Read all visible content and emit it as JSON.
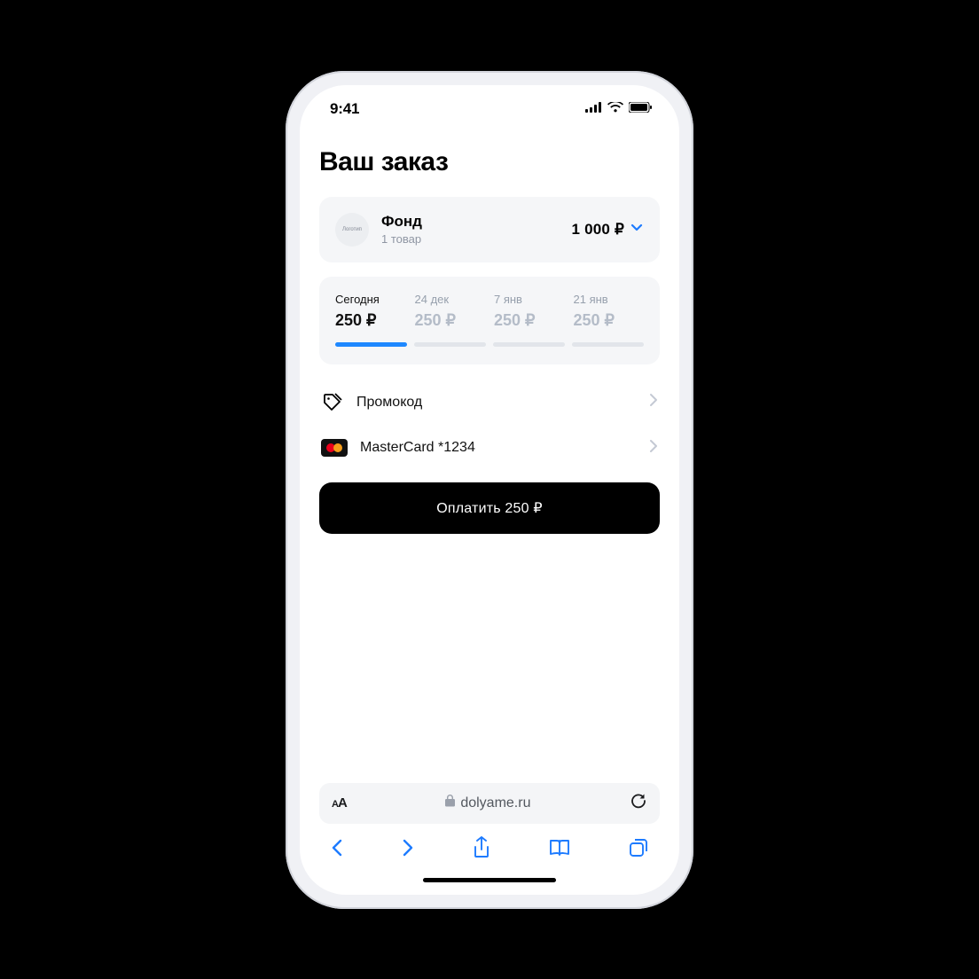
{
  "status_bar": {
    "time": "9:41"
  },
  "page": {
    "title": "Ваш заказ"
  },
  "merchant": {
    "logo_text": "Логотип",
    "name": "Фонд",
    "subtitle": "1 товар",
    "amount": "1 000 ₽"
  },
  "schedule": [
    {
      "label": "Сегодня",
      "amount": "250 ₽",
      "active": true
    },
    {
      "label": "24 дек",
      "amount": "250 ₽",
      "active": false
    },
    {
      "label": "7 янв",
      "amount": "250 ₽",
      "active": false
    },
    {
      "label": "21 янв",
      "amount": "250 ₽",
      "active": false
    }
  ],
  "promo": {
    "label": "Промокод"
  },
  "payment_method": {
    "label": "MasterCard *1234"
  },
  "pay_button": {
    "label": "Оплатить 250 ₽"
  },
  "address_bar": {
    "domain": "dolyame.ru"
  },
  "colors": {
    "accent_blue": "#1d7bff"
  }
}
